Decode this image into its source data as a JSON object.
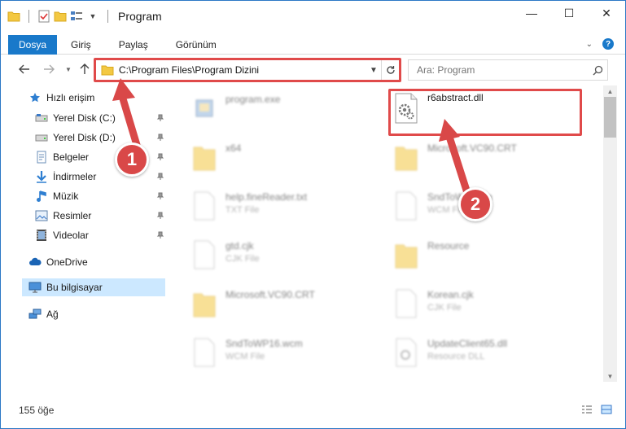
{
  "window": {
    "title": "Program",
    "controls": {
      "minimize": "—",
      "maximize": "☐",
      "close": "✕"
    }
  },
  "ribbon": {
    "tabs": [
      {
        "label": "Dosya"
      },
      {
        "label": "Giriş"
      },
      {
        "label": "Paylaş"
      },
      {
        "label": "Görünüm"
      }
    ],
    "accent_color": "#1979ca"
  },
  "address": {
    "path": "C:\\Program Files\\Program Dizini",
    "search_placeholder": "Ara: Program"
  },
  "sidebar": {
    "items": [
      {
        "label": "Hızlı erişim",
        "icon": "star-icon"
      },
      {
        "label": "Yerel Disk (C:)",
        "icon": "drive-icon",
        "pinned": true
      },
      {
        "label": "Yerel Disk (D:)",
        "icon": "drive-icon",
        "pinned": true
      },
      {
        "label": "Belgeler",
        "icon": "documents-icon",
        "pinned": true
      },
      {
        "label": "İndirmeler",
        "icon": "download-icon",
        "pinned": true
      },
      {
        "label": "Müzik",
        "icon": "music-icon",
        "pinned": true
      },
      {
        "label": "Resimler",
        "icon": "pictures-icon",
        "pinned": true
      },
      {
        "label": "Videolar",
        "icon": "video-icon",
        "pinned": true
      },
      {
        "label": "OneDrive",
        "icon": "cloud-icon"
      },
      {
        "label": "Bu bilgisayar",
        "icon": "computer-icon",
        "selected": true
      },
      {
        "label": "Ağ",
        "icon": "network-icon"
      }
    ]
  },
  "files": [
    {
      "name": "program.exe",
      "sub": "",
      "icon": "exe-icon"
    },
    {
      "name": "r6abstract.dll",
      "sub": "",
      "icon": "dll-gear-icon",
      "highlighted": true
    },
    {
      "name": "x64",
      "sub": "",
      "icon": "folder-icon"
    },
    {
      "name": "Microsoft.VC90.CRT",
      "sub": "",
      "icon": "folder-icon"
    },
    {
      "name": "help.fineReader.txt",
      "sub": "TXT File",
      "icon": "file-icon"
    },
    {
      "name": "SndToWP.wcm",
      "sub": "WCM File",
      "icon": "file-icon"
    },
    {
      "name": "gtd.cjk",
      "sub": "CJK File",
      "icon": "file-icon"
    },
    {
      "name": "Resource",
      "sub": "",
      "icon": "folder-icon"
    },
    {
      "name": "Microsoft.VC90.CRT",
      "sub": "",
      "icon": "folder-icon"
    },
    {
      "name": "Korean.cjk",
      "sub": "CJK File",
      "icon": "file-icon"
    },
    {
      "name": "SndToWP16.wcm",
      "sub": "WCM File",
      "icon": "file-icon"
    },
    {
      "name": "UpdateClient65.dll",
      "sub": "Resource DLL",
      "icon": "dll-gear-icon"
    }
  ],
  "status": {
    "item_count": "155 öğe"
  },
  "annotations": {
    "callout_1": "1",
    "callout_2": "2",
    "highlight_color": "#e04a4a"
  }
}
